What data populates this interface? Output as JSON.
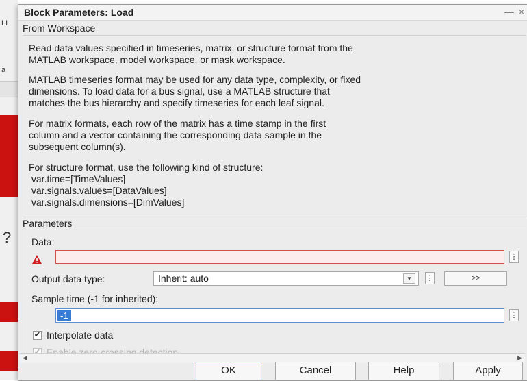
{
  "background": {
    "fragments": [
      "LI",
      "a"
    ],
    "qmark": "?",
    "accent_color": "#cc1111"
  },
  "dialog": {
    "title": "Block Parameters: Load",
    "minimize_icon": "minimize-icon",
    "close_icon": "close-icon",
    "block_type": "From Workspace",
    "description": [
      "Read data values specified in timeseries, matrix, or structure format from the\nMATLAB workspace, model workspace, or mask workspace.",
      "MATLAB timeseries format may be used for any data type, complexity, or fixed\ndimensions. To load data for a bus signal, use a MATLAB structure that\nmatches the bus hierarchy and specify timeseries for each leaf signal.",
      "For matrix formats, each row of the matrix has a time stamp in the first\ncolumn and a vector containing the corresponding data sample in the\nsubsequent column(s).",
      "For structure format, use the following kind of structure:\n var.time=[TimeValues]\n var.signals.values=[DataValues]\n var.signals.dimensions=[DimValues]"
    ],
    "parameters": {
      "section_label": "Parameters",
      "data_label": "Data:",
      "data_value": "",
      "output_type_label": "Output data type:",
      "output_type_value": "Inherit: auto",
      "assistant_label": ">>",
      "sample_time_label": "Sample time (-1 for inherited):",
      "sample_time_value": "-1",
      "interpolate_label": "Interpolate data",
      "interpolate_checked": true,
      "zero_crossing_label": "Enable zero-crossing detection",
      "zero_crossing_checked": true,
      "zero_crossing_enabled": false
    },
    "buttons": {
      "ok": "OK",
      "cancel": "Cancel",
      "help": "Help",
      "apply": "Apply"
    },
    "colors": {
      "error_border": "#d05050",
      "error_fill": "#fdecec",
      "selection": "#3a7bd5"
    }
  }
}
